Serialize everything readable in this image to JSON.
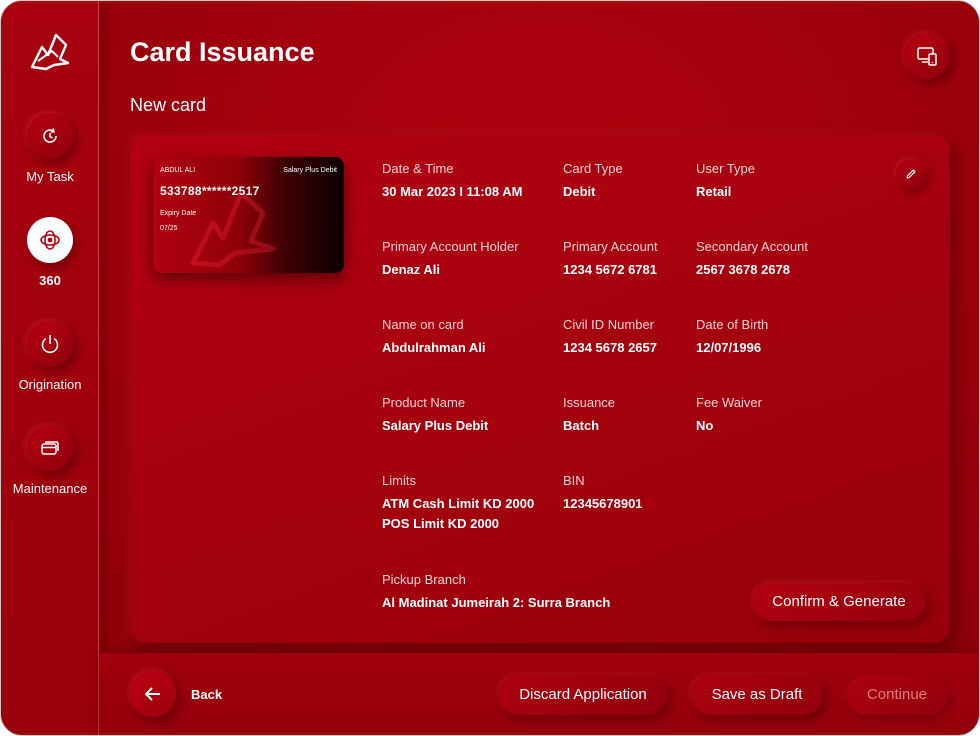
{
  "sidebar": {
    "logo_icon": "bank-logo",
    "items": [
      {
        "label": "My Task",
        "icon": "refresh-clock-icon"
      },
      {
        "label": "360",
        "icon": "360-icon"
      },
      {
        "label": "Origination",
        "icon": "power-icon"
      },
      {
        "label": "Maintenance",
        "icon": "cards-icon"
      }
    ]
  },
  "header": {
    "title": "Card Issuance",
    "subtitle": "New card",
    "device_icon": "devices-icon"
  },
  "card_preview": {
    "holder": "ABDUL ALI",
    "product": "Salary Plus Debit",
    "number": "533788******2517",
    "expiry_label": "Expiry Date",
    "expiry": "07/25"
  },
  "details": {
    "date_time": {
      "label": "Date & Time",
      "value": "30 Mar 2023 I 11:08 AM"
    },
    "card_type": {
      "label": "Card Type",
      "value": "Debit"
    },
    "user_type": {
      "label": "User Type",
      "value": "Retail"
    },
    "primary_holder": {
      "label": "Primary Account Holder",
      "value": "Denaz Ali"
    },
    "primary_account": {
      "label": "Primary Account",
      "value": "1234 5672 6781"
    },
    "secondary_account": {
      "label": "Secondary Account",
      "value": "2567 3678 2678"
    },
    "name_on_card": {
      "label": "Name on card",
      "value": "Abdulrahman Ali"
    },
    "civil_id": {
      "label": "Civil ID Number",
      "value": "1234 5678 2657"
    },
    "dob": {
      "label": "Date of Birth",
      "value": "12/07/1996"
    },
    "product_name": {
      "label": "Product Name",
      "value": "Salary Plus Debit"
    },
    "issuance": {
      "label": "Issuance",
      "value": "Batch"
    },
    "fee_waiver": {
      "label": "Fee Waiver",
      "value": "No"
    },
    "limits": {
      "label": "Limits",
      "value_1": "ATM Cash Limit KD 2000",
      "value_2": "POS Limit KD 2000"
    },
    "bin": {
      "label": "BIN",
      "value": "12345678901"
    },
    "pickup_branch": {
      "label": "Pickup Branch",
      "value": "Al Madinat Jumeirah 2: Surra Branch"
    }
  },
  "actions": {
    "confirm": "Confirm & Generate",
    "back": "Back",
    "discard": "Discard Application",
    "save_draft": "Save as Draft",
    "continue": "Continue"
  },
  "colors": {
    "brand_red": "#a5000e",
    "accent_white": "#ffffff",
    "disabled_text": "#e07c84"
  }
}
